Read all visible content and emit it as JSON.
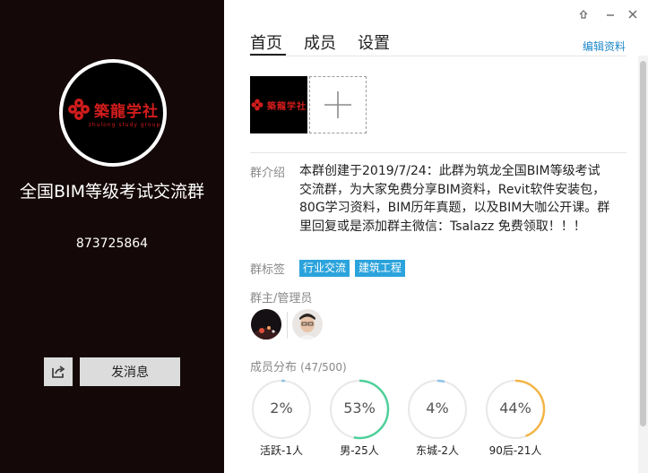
{
  "left_panel": {
    "logo_text": "築龍学社",
    "logo_subtext": "zhulong study group",
    "group_name": "全国BIM等级考试交流群",
    "group_id": "873725864",
    "send_message_label": "发消息",
    "share_icon": "share-icon"
  },
  "window_controls": {
    "pin_icon": "pin-icon",
    "minimize_icon": "minimize-icon",
    "close_icon": "close-icon"
  },
  "tabs": [
    {
      "label": "首页",
      "active": true
    },
    {
      "label": "成员",
      "active": false
    },
    {
      "label": "设置",
      "active": false
    }
  ],
  "edit_label": "编辑资料",
  "intro": {
    "label": "群介绍",
    "text": "本群创建于2019/7/24：此群为筑龙全国BIM等级考试交流群，为大家免费分享BIM资料，Revit软件安装包，80G学习资料，BIM历年真题，以及BIM大咖公开课。群里回复或是添加群主微信：Tsalazz 免费领取！！！"
  },
  "tags": {
    "label": "群标签",
    "items": [
      "行业交流",
      "建筑工程"
    ]
  },
  "admins": {
    "label": "群主/管理员"
  },
  "distribution": {
    "label": "成员分布",
    "count": "(47/500)",
    "items": [
      {
        "pct": 2,
        "pct_text": "2%",
        "caption": "活跃-1人",
        "color": "#8fc3e6"
      },
      {
        "pct": 53,
        "pct_text": "53%",
        "caption": "男-25人",
        "color": "#4fcf9a"
      },
      {
        "pct": 4,
        "pct_text": "4%",
        "caption": "东城-2人",
        "color": "#8fc3e6"
      },
      {
        "pct": 44,
        "pct_text": "44%",
        "caption": "90后-21人",
        "color": "#f3b546"
      }
    ]
  },
  "colors": {
    "accent": "#2ba3dc",
    "link": "#1e88c9",
    "left_bg": "#150808",
    "brand_red": "#d11c1c"
  }
}
